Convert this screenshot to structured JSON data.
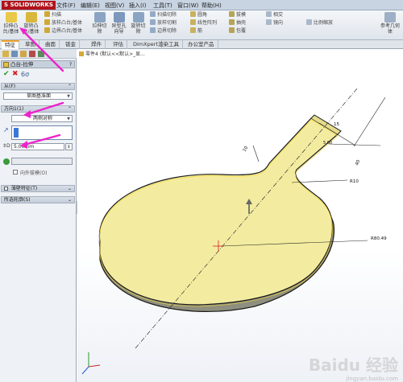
{
  "app": {
    "logo": "S SOLIDWORKS",
    "menu": [
      "文件(F)",
      "编辑(E)",
      "视图(V)",
      "插入(I)",
      "工具(T)",
      "窗口(W)",
      "帮助(H)"
    ]
  },
  "ribbon": {
    "big_buttons": [
      "拉伸凸台/基体",
      "旋转凸台/基体",
      "拉伸切除",
      "异型孔向导",
      "旋转切除",
      "参考几何体"
    ],
    "small_buttons": [
      "扫描",
      "放样凸台/基体",
      "边界凸台/基体",
      "扫描切除",
      "放样切割",
      "边界切除",
      "圆角",
      "线性阵列",
      "筋",
      "拔模",
      "抽壳",
      "包覆",
      "相交",
      "镜向",
      "比例缩放"
    ]
  },
  "tabs": [
    "特征",
    "草图",
    "曲面",
    "钣金",
    "焊件",
    "评估",
    "DimXpert",
    "办公室产品",
    "渲染工具"
  ],
  "feature_tree": {
    "part_name": "零件4 (默认<<默认>_显...",
    "dots": "..."
  },
  "panel": {
    "title": "凸台-拉伸",
    "help": "?",
    "from_header": "从(F)",
    "from_value": "草图基准面",
    "dir_header": "方向1(1)",
    "dir_value": "两侧对称",
    "depth_value": "5.00mm",
    "draft_label": "向外拔模(O)",
    "thin_header": "薄壁特征(T)",
    "contours_header": "所选轮廓(S)",
    "chevron": "⌄"
  },
  "dimensions": [
    "R80.49",
    "R10",
    "40",
    "15",
    "5.00",
    "10"
  ],
  "watermark": {
    "text": "Baidu 经验",
    "url": "jingyan.baidu.com"
  },
  "colors": {
    "accent": "#f2a12a",
    "model_fill": "#f3eca0",
    "model_edge": "#1a1a1a",
    "arrow_annotation": "#ee22cc"
  }
}
